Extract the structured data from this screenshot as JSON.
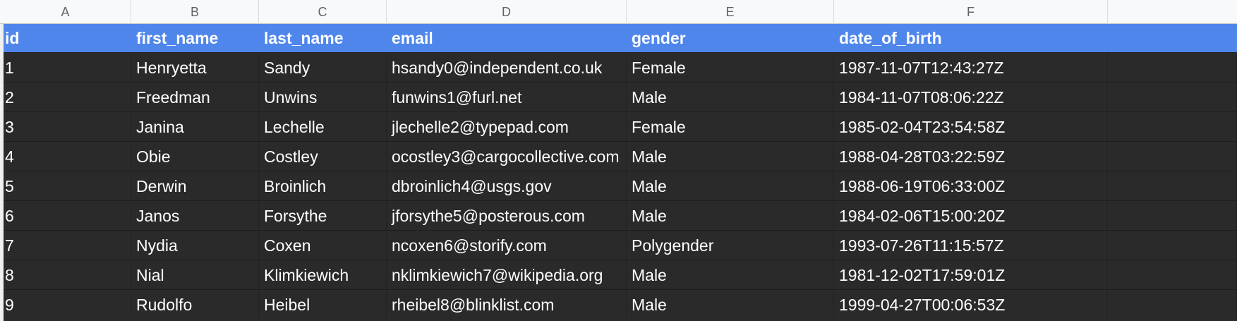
{
  "columns": [
    "A",
    "B",
    "C",
    "D",
    "E",
    "F"
  ],
  "headers": [
    "id",
    "first_name",
    "last_name",
    "email",
    "gender",
    "date_of_birth"
  ],
  "rows": [
    [
      "1",
      "Henryetta",
      "Sandy",
      "hsandy0@independent.co.uk",
      "Female",
      "1987-11-07T12:43:27Z"
    ],
    [
      "2",
      "Freedman",
      "Unwins",
      "funwins1@furl.net",
      "Male",
      "1984-11-07T08:06:22Z"
    ],
    [
      "3",
      "Janina",
      "Lechelle",
      "jlechelle2@typepad.com",
      "Female",
      "1985-02-04T23:54:58Z"
    ],
    [
      "4",
      "Obie",
      "Costley",
      "ocostley3@cargocollective.com",
      "Male",
      "1988-04-28T03:22:59Z"
    ],
    [
      "5",
      "Derwin",
      "Broinlich",
      "dbroinlich4@usgs.gov",
      "Male",
      "1988-06-19T06:33:00Z"
    ],
    [
      "6",
      "Janos",
      "Forsythe",
      "jforsythe5@posterous.com",
      "Male",
      "1984-02-06T15:00:20Z"
    ],
    [
      "7",
      "Nydia",
      "Coxen",
      "ncoxen6@storify.com",
      "Polygender",
      "1993-07-26T11:15:57Z"
    ],
    [
      "8",
      "Nial",
      "Klimkiewich",
      "nklimkiewich7@wikipedia.org",
      "Male",
      "1981-12-02T17:59:01Z"
    ],
    [
      "9",
      "Rudolfo",
      "Heibel",
      "rheibel8@blinklist.com",
      "Male",
      "1999-04-27T00:06:53Z"
    ]
  ],
  "colors": {
    "header_fill": "#4f86ec",
    "cell_fill": "#2a2a2a",
    "cell_text": "#ffffff",
    "column_letter_text": "#5f6368"
  }
}
